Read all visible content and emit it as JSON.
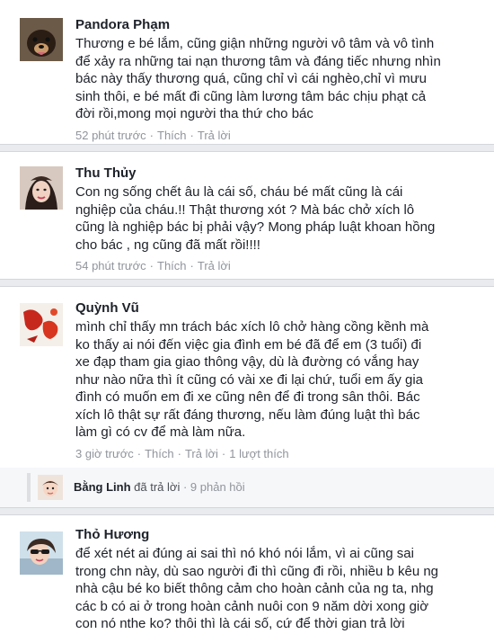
{
  "comments": [
    {
      "author": "Pandora Phạm",
      "lines": [
        "Thương e bé lắm, cũng giận những người vô tâm và vô tình",
        "để xảy ra những tai nạn thương tâm và đáng tiếc nhưng nhìn",
        "bác này thấy thương quá, cũng chỉ vì cái nghèo,chỉ vì mưu",
        "sinh thôi, e bé mất đi cũng làm lương tâm bác chịu phạt cả",
        "đời rồi,mong mọi người tha thứ cho bác"
      ],
      "time": "52 phút trước",
      "like": "Thích",
      "reply": "Trả lời"
    },
    {
      "author": "Thu Thủy",
      "lines": [
        "Con ng sống chết âu là cái số, cháu bé mất cũng là cái",
        "nghiệp của cháu.!! Thật thương xót ? Mà bác chở xích lô",
        "cũng là nghiệp bác bị phải vậy? Mong pháp luật khoan hồng",
        "cho bác , ng cũng đã mất rồi!!!!"
      ],
      "time": "54 phút trước",
      "like": "Thích",
      "reply": "Trả lời"
    },
    {
      "author": "Quỳnh Vũ",
      "lines": [
        "mình chỉ thấy mn trách bác xích lô chở hàng cồng kềnh mà",
        "ko thấy ai nói đến việc gia đình em bé đã để em (3 tuổi) đi",
        "xe đạp tham gia giao thông vậy, dù là đường có vắng hay",
        "như nào nữa thì ít cũng có vài xe đi lại chứ, tuổi em ấy gia",
        "đình có muốn em đi xe cũng nên để đi trong sân thôi. Bác",
        "xích lô thật sự rất đáng thương, nếu làm đúng luật thì bác",
        "làm gì có cv để mà làm nữa."
      ],
      "time": "3 giờ trước",
      "like": "Thích",
      "reply": "Trả lời",
      "likes_count": "1 lượt thích"
    },
    {
      "author": "Thỏ Hương",
      "lines": [
        "để xét nét ai đúng ai sai thì nó khó nói lắm, vì ai cũng sai",
        "trong chn này, dù sao người đi thì cũng đi rồi, nhiều b kêu ng",
        "nhà cậu bé ko biết thông cảm cho hoàn cảnh của ng ta, nhg",
        "các b có ai ở trong hoàn cảnh nuôi con 9 năm dời xong giờ",
        "con nó nthe ko? thôi thì là cái số, cứ để thời gian trả lời"
      ]
    }
  ],
  "reply_summary": {
    "name": "Bằng Linh",
    "action": "đã trả lời",
    "sep": "·",
    "count": "9 phản hồi"
  },
  "meta_separator": "·",
  "icons": [
    "avatar-dog",
    "avatar-woman",
    "avatar-red-abstract",
    "avatar-child",
    "avatar-girl-sunglasses"
  ]
}
